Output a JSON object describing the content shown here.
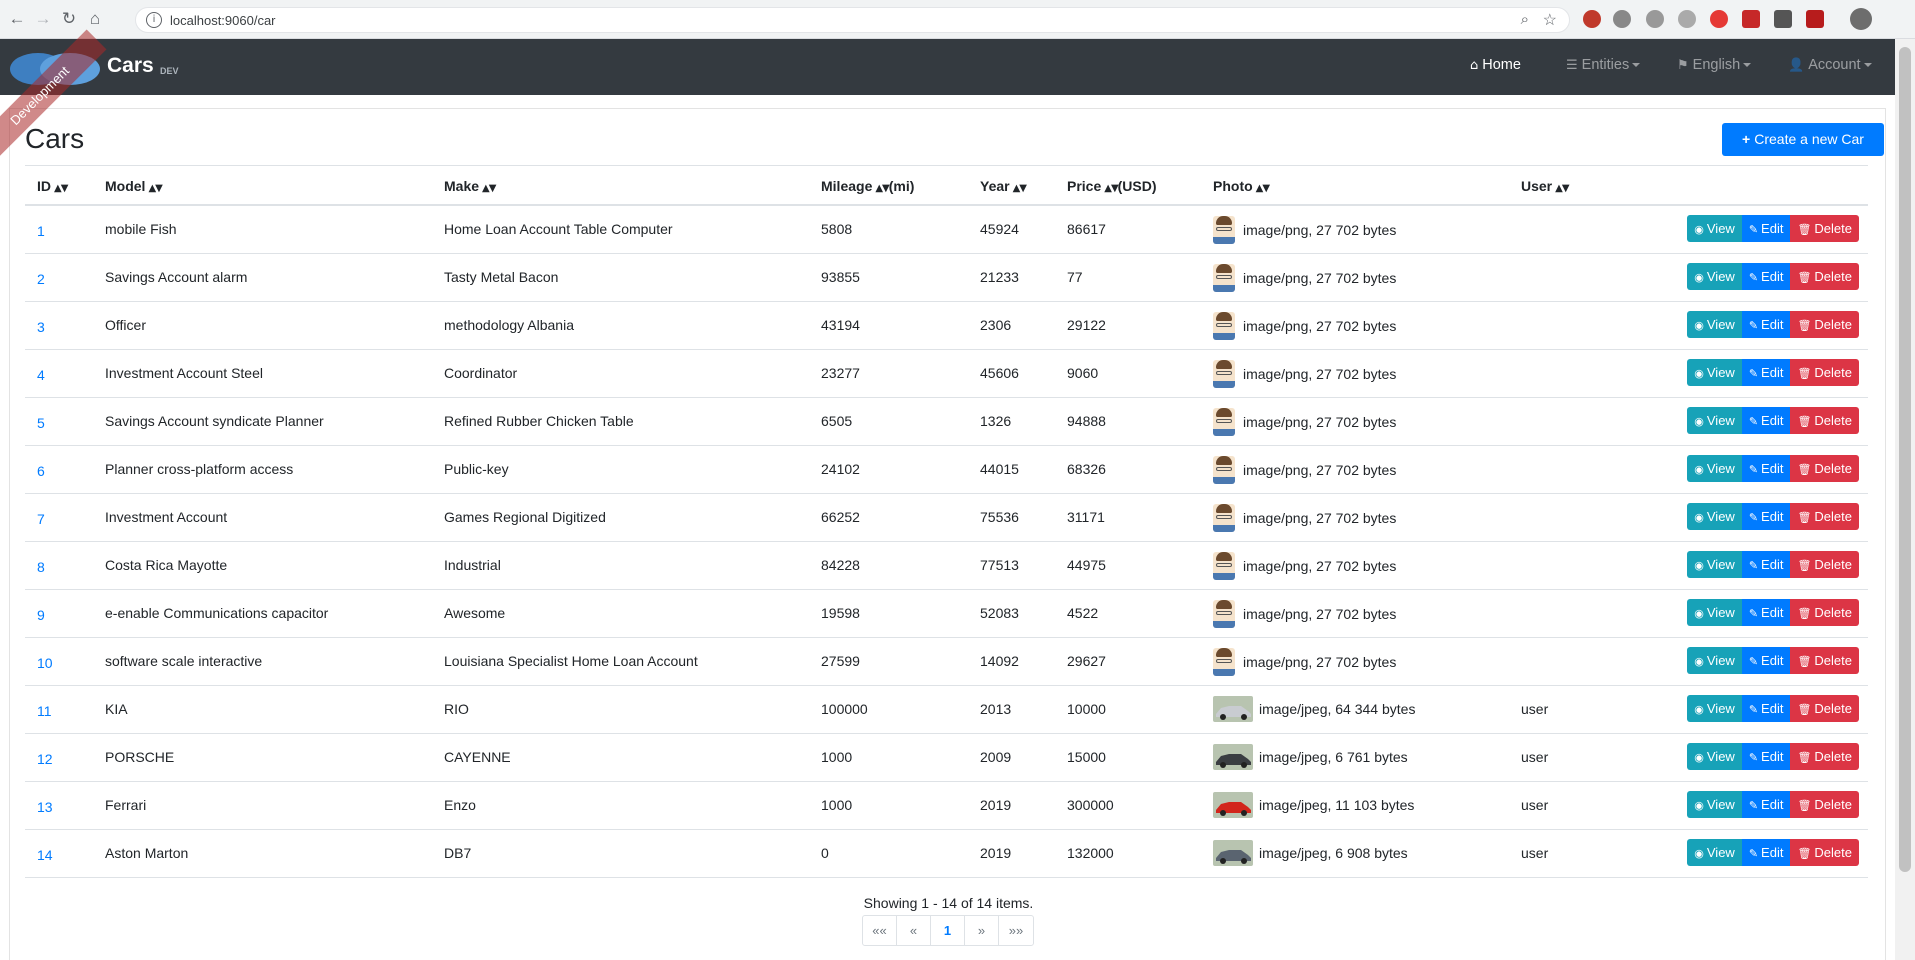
{
  "browser": {
    "url": "localhost:9060/car",
    "back_icon": "←",
    "forward_icon": "→",
    "reload_icon": "↻",
    "home_icon": "⌂"
  },
  "navbar": {
    "brand": "Cars",
    "version": "DEV",
    "ribbon": "Development",
    "links": [
      {
        "label": "Home",
        "icon": "home-icon"
      },
      {
        "label": "Entities",
        "icon": "list-icon"
      },
      {
        "label": "English",
        "icon": "flag-icon"
      },
      {
        "label": "Account",
        "icon": "user-icon"
      }
    ]
  },
  "page": {
    "title": "Cars",
    "create_label": "Create a new Car"
  },
  "columns": [
    {
      "label": "ID",
      "unit": ""
    },
    {
      "label": "Model",
      "unit": ""
    },
    {
      "label": "Make",
      "unit": ""
    },
    {
      "label": "Mileage",
      "unit": "(mi)"
    },
    {
      "label": "Year",
      "unit": ""
    },
    {
      "label": "Price",
      "unit": "(USD)"
    },
    {
      "label": "Photo",
      "unit": ""
    },
    {
      "label": "User",
      "unit": ""
    }
  ],
  "rows": [
    {
      "id": "1",
      "model": "mobile Fish",
      "make": "Home Loan Account Table Computer",
      "mileage": "5808",
      "year": "45924",
      "price": "86617",
      "photo": "image/png, 27 702 bytes",
      "photo_kind": "avatar",
      "user": ""
    },
    {
      "id": "2",
      "model": "Savings Account alarm",
      "make": "Tasty Metal Bacon",
      "mileage": "93855",
      "year": "21233",
      "price": "77",
      "photo": "image/png, 27 702 bytes",
      "photo_kind": "avatar",
      "user": ""
    },
    {
      "id": "3",
      "model": "Officer",
      "make": "methodology Albania",
      "mileage": "43194",
      "year": "2306",
      "price": "29122",
      "photo": "image/png, 27 702 bytes",
      "photo_kind": "avatar",
      "user": ""
    },
    {
      "id": "4",
      "model": "Investment Account Steel",
      "make": "Coordinator",
      "mileage": "23277",
      "year": "45606",
      "price": "9060",
      "photo": "image/png, 27 702 bytes",
      "photo_kind": "avatar",
      "user": ""
    },
    {
      "id": "5",
      "model": "Savings Account syndicate Planner",
      "make": "Refined Rubber Chicken Table",
      "mileage": "6505",
      "year": "1326",
      "price": "94888",
      "photo": "image/png, 27 702 bytes",
      "photo_kind": "avatar",
      "user": ""
    },
    {
      "id": "6",
      "model": "Planner cross-platform access",
      "make": "Public-key",
      "mileage": "24102",
      "year": "44015",
      "price": "68326",
      "photo": "image/png, 27 702 bytes",
      "photo_kind": "avatar",
      "user": ""
    },
    {
      "id": "7",
      "model": "Investment Account",
      "make": "Games Regional Digitized",
      "mileage": "66252",
      "year": "75536",
      "price": "31171",
      "photo": "image/png, 27 702 bytes",
      "photo_kind": "avatar",
      "user": ""
    },
    {
      "id": "8",
      "model": "Costa Rica Mayotte",
      "make": "Industrial",
      "mileage": "84228",
      "year": "77513",
      "price": "44975",
      "photo": "image/png, 27 702 bytes",
      "photo_kind": "avatar",
      "user": ""
    },
    {
      "id": "9",
      "model": "e-enable Communications capacitor",
      "make": "Awesome",
      "mileage": "19598",
      "year": "52083",
      "price": "4522",
      "photo": "image/png, 27 702 bytes",
      "photo_kind": "avatar",
      "user": ""
    },
    {
      "id": "10",
      "model": "software scale interactive",
      "make": "Louisiana Specialist Home Loan Account",
      "mileage": "27599",
      "year": "14092",
      "price": "29627",
      "photo": "image/png, 27 702 bytes",
      "photo_kind": "avatar",
      "user": ""
    },
    {
      "id": "11",
      "model": "KIA",
      "make": "RIO",
      "mileage": "100000",
      "year": "2013",
      "price": "10000",
      "photo": "image/jpeg, 64 344 bytes",
      "photo_kind": "car",
      "car_color": "#c9ccd1",
      "user": "user"
    },
    {
      "id": "12",
      "model": "PORSCHE",
      "make": "CAYENNE",
      "mileage": "1000",
      "year": "2009",
      "price": "15000",
      "photo": "image/jpeg, 6 761 bytes",
      "photo_kind": "car",
      "car_color": "#3a3d42",
      "user": "user"
    },
    {
      "id": "13",
      "model": "Ferrari",
      "make": "Enzo",
      "mileage": "1000",
      "year": "2019",
      "price": "300000",
      "photo": "image/jpeg, 11 103 bytes",
      "photo_kind": "car",
      "car_color": "#d2261c",
      "user": "user"
    },
    {
      "id": "14",
      "model": "Aston Marton",
      "make": "DB7",
      "mileage": "0",
      "year": "2019",
      "price": "132000",
      "photo": "image/jpeg, 6 908 bytes",
      "photo_kind": "car",
      "car_color": "#5a6470",
      "user": "user"
    }
  ],
  "actions": {
    "view": "View",
    "edit": "Edit",
    "delete": "Delete"
  },
  "summary": "Showing 1 - 14 of 14 items.",
  "pager": [
    "««",
    "«",
    "1",
    "»",
    "»»"
  ],
  "colors": {
    "navbar": "#343a40",
    "primary": "#007bff",
    "info": "#17a2b8",
    "danger": "#dc3545"
  }
}
